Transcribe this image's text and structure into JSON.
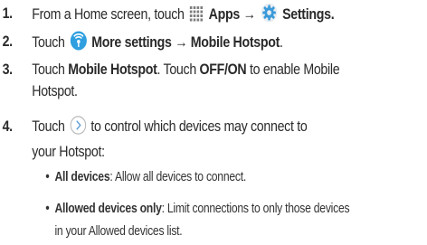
{
  "colors": {
    "text": "#2a2a2a",
    "apps_icon": "#7d7d7d",
    "settings_icon": "#3a9ad9",
    "more_settings_icon": "#2f9fe0",
    "chevron_circle": "#b8b8b8"
  },
  "icons": {
    "apps": "apps-grid-icon",
    "settings": "settings-gear-icon",
    "more_settings": "more-settings-icon",
    "next": "chevron-right-circle-icon"
  },
  "steps": [
    {
      "number": "1.",
      "line1": {
        "t1": "From a Home screen, touch",
        "apps": "Apps",
        "arrow": "→",
        "settings": "Settings",
        "end": "."
      }
    },
    {
      "number": "2.",
      "line1": {
        "t1": "Touch",
        "more_settings": "More settings",
        "arrow": "→",
        "mobile_hotspot": "Mobile Hotspot",
        "end": "."
      }
    },
    {
      "number": "3.",
      "line1": {
        "t1": "Touch",
        "mobile_hotspot": "Mobile Hotspot",
        "t2": ". Touch",
        "off_on": "OFF/ON",
        "t3": "to enable Mobile"
      },
      "line2": "Hotspot."
    },
    {
      "number": "4.",
      "line1": {
        "t1": "Touch",
        "t2": "to control which devices may connect to"
      },
      "line2": "your Hotspot:"
    }
  ],
  "bullets": [
    {
      "dot": "•",
      "label": "All devices",
      "text": ": Allow all devices to connect."
    },
    {
      "dot": "•",
      "label": "Allowed devices only",
      "text": ": Limit connections to only those devices",
      "line2": "in your Allowed devices list."
    }
  ]
}
